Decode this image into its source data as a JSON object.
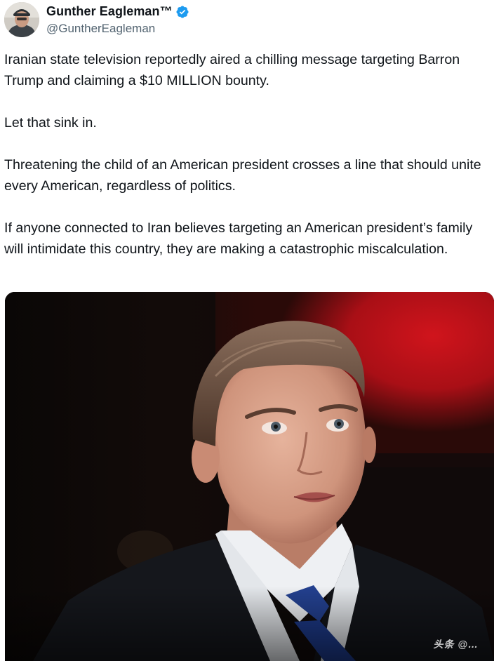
{
  "author": {
    "display_name": "Gunther Eagleman™",
    "handle": "@GuntherEagleman",
    "avatar_icon": "profile-photo",
    "verified_icon": "verified-badge-icon",
    "verified_color": "#1d9bf0"
  },
  "tweet": {
    "paragraphs": [
      "Iranian state television reportedly aired a chilling message targeting Barron Trump and claiming a $10 MILLION bounty.",
      "Let that sink in.",
      "Threatening the child of an American president crosses a line that should unite every American, regardless of politics.",
      "If anyone connected to Iran believes targeting an American president’s family will intimidate this country, they are making a catastrophic miscalculation."
    ]
  },
  "media": {
    "type": "photo",
    "watermark": "头条 @… ",
    "colors": {
      "background_red": "#c8121a",
      "background_dark": "#0d0908",
      "suit": "#14161c",
      "tie": "#1d3a8a",
      "skin": "#d8a08a",
      "hair": "#6a5040"
    }
  }
}
